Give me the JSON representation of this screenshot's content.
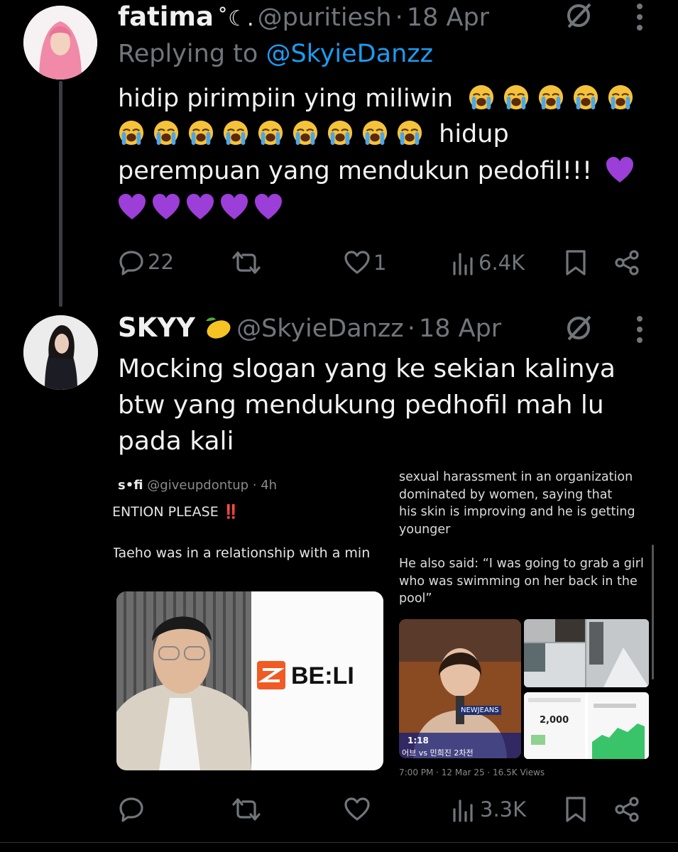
{
  "tweets": [
    {
      "name": "fatima",
      "name_suffix": "˚☾.",
      "handle": "@puritiesh",
      "sep": "·",
      "date": "18 Apr",
      "replying_prefix": "Replying to",
      "replying_handle": "@SkyieDanzz",
      "line1": "hidip pirimpiin ying miliwin",
      "line2_tail": "hidup",
      "line3": "perempuan yang mendukun pedofil!!!",
      "replies": "22",
      "retweets": "",
      "likes": "1",
      "views": "6.4K"
    },
    {
      "name": "SKYY",
      "handle": "@SkyieDanzz",
      "sep": "·",
      "date": "18 Apr",
      "line1": "Mocking slogan yang ke sekian kalinya",
      "line2": "btw yang mendukung pedhofil mah lu",
      "line3": "pada kali",
      "replies": "",
      "retweets": "",
      "likes": "",
      "views": "3.3K"
    }
  ],
  "embed_left": {
    "user": "s•fi",
    "handle_time": "@giveupdontup · 4h",
    "heading": "ENTION PLEASE",
    "alert_mark": "‼️",
    "line": "Taeho was in a relationship with a min",
    "logo_text": "BE:LI"
  },
  "embed_right": {
    "p1_lines": [
      "sexual harassment in an organization",
      "dominated by women, saying that",
      "his skin is improving and he is getting",
      "younger"
    ],
    "p2_lines": [
      "He also said: “I was going to grab a girl",
      "who was swimming on her back in the",
      "pool”"
    ],
    "video_time": "1:18",
    "video_caption": "어브 vs 민희진 2차전",
    "video_badge": "NEWJEANS",
    "app_value": "2,000",
    "footer": "7:00 PM · 12 Mar 25 · 16.5K Views"
  },
  "icons": [
    "more-icon",
    "grok-icon",
    "reply-icon",
    "retweet-icon",
    "like-icon",
    "views-icon",
    "bookmark-icon",
    "share-icon",
    "loudly-crying-emoji",
    "purple-heart-emoji",
    "lemon-emoji"
  ],
  "colors": {
    "background": "#000000",
    "accent": "#1d9bf0",
    "muted": "#71767b",
    "heart": "#9b3fd8"
  }
}
